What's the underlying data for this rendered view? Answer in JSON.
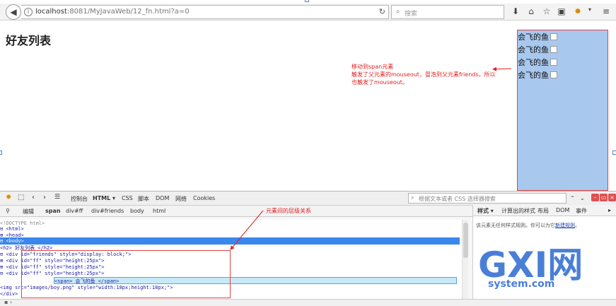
{
  "browser": {
    "url_host": "localhost",
    "url_rest": ":8081/MyJavaWeb/12_fn.html?a=0",
    "search_placeholder": "搜索",
    "search_icon": "magnifier-icon"
  },
  "page": {
    "title": "好友列表",
    "friends": [
      {
        "name": "会飞的鱼"
      },
      {
        "name": "会飞的鱼"
      },
      {
        "name": "会飞的鱼"
      },
      {
        "name": "会飞的鱼"
      }
    ],
    "annotation_top": [
      "移动到span元素",
      "触发了父元素的mouseout，冒泡到父元素friends，所以",
      "也触发了mouseout。"
    ],
    "annotation_bottom": "元素间的层级关系"
  },
  "devtools": {
    "tabs": [
      "控制台",
      "HTML ▾",
      "CSS",
      "脚本",
      "DOM",
      "网络",
      "Cookies"
    ],
    "search_placeholder": "根据文本或者 CSS 选择器搜索",
    "edit_label": "编辑",
    "crumbs": [
      "span",
      "div#ff",
      "div#friends",
      "body",
      "html"
    ],
    "tree": [
      "<!DOCTYPE html>",
      "⊟ <html>",
      "  ⊞ <head>",
      "  ⊟ <body>",
      "      <h2> 好友列表 </h2>",
      "    ⊟ <div  id=\"friends\"  style=\"display: block;\">",
      "      ⊞ <div  id=\"ff\"  style=\"height:25px\">",
      "      ⊞ <div  id=\"ff\"  style=\"height:25px\">",
      "      ⊟ <div  id=\"ff\"  style=\"height:25px\">",
      "            <span> 会飞的鱼 </span>",
      "            <img  src=\"images/boy.png\"  style=\"width:18px;height:18px;\">",
      "          </div>"
    ],
    "side_tabs": [
      "样式 ▾",
      "计算出的样式",
      "布局",
      "DOM",
      "事件"
    ],
    "side_msg": "该元素无任何样式规则。你可以为它",
    "side_link": "新建规则",
    "side_msg_end": "。"
  },
  "watermark": {
    "big": "GXI网",
    "small": "system.com"
  }
}
